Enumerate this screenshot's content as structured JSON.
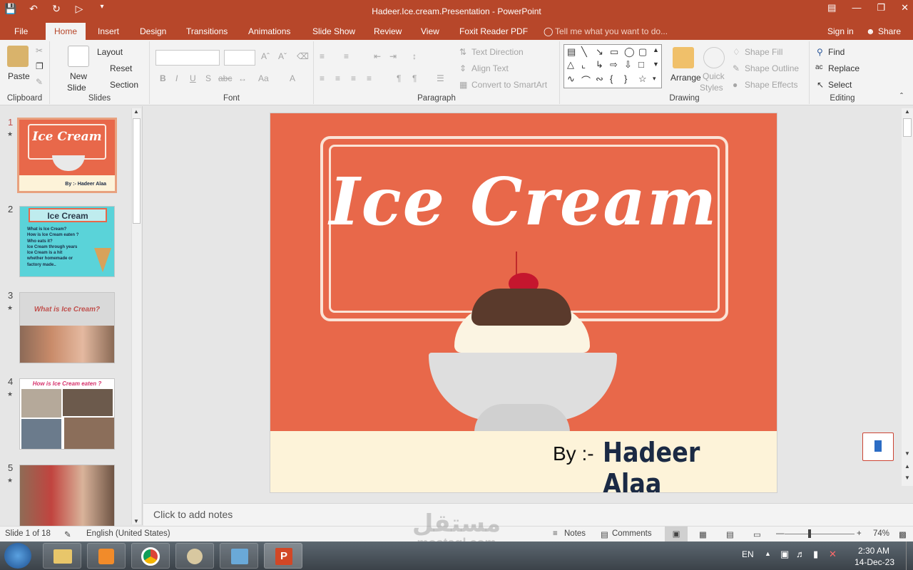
{
  "window": {
    "title": "Hadeer.Ice.cream.Presentation - PowerPoint"
  },
  "tabs": [
    "File",
    "Home",
    "Insert",
    "Design",
    "Transitions",
    "Animations",
    "Slide Show",
    "Review",
    "View",
    "Foxit Reader PDF"
  ],
  "tell_me": "Tell me what you want to do...",
  "sign_in": "Sign in",
  "share": "Share",
  "ribbon": {
    "clipboard": {
      "label": "Clipboard",
      "paste": "Paste"
    },
    "slides": {
      "label": "Slides",
      "new_slide": "New",
      "new_slide2": "Slide",
      "layout": "Layout",
      "reset": "Reset",
      "section": "Section"
    },
    "font": {
      "label": "Font"
    },
    "paragraph": {
      "label": "Paragraph",
      "text_direction": "Text Direction",
      "align_text": "Align Text",
      "convert_smartart": "Convert to SmartArt"
    },
    "drawing": {
      "label": "Drawing",
      "arrange": "Arrange",
      "quick": "Quick",
      "styles": "Styles",
      "shape_fill": "Shape Fill",
      "shape_outline": "Shape Outline",
      "shape_effects": "Shape Effects"
    },
    "editing": {
      "label": "Editing",
      "find": "Find",
      "replace": "Replace",
      "select": "Select"
    }
  },
  "thumbnails": [
    {
      "num": "1",
      "title": "Ice Cream",
      "sub": "By :- Hadeer Alaa"
    },
    {
      "num": "2",
      "title": "Ice Cream",
      "bullets": [
        "What is Ice Cream?",
        "How is Ice Cream eaten ?",
        "Who eats it?",
        "Ice Cream through years",
        "Ice Cream is a hit",
        "whether homemade or",
        "factory made.."
      ]
    },
    {
      "num": "3",
      "title": "What is Ice Cream?"
    },
    {
      "num": "4",
      "title": "How is Ice Cream eaten ?"
    },
    {
      "num": "5"
    }
  ],
  "slide": {
    "title": "Ice Cream",
    "by": "By :- ",
    "author": "Hadeer Alaa"
  },
  "notes_placeholder": "Click to add notes",
  "status": {
    "slide_of": "Slide 1 of 18",
    "language": "English (United States)",
    "notes": "Notes",
    "comments": "Comments",
    "zoom": "74%"
  },
  "taskbar": {
    "lang": "EN",
    "time": "2:30 AM",
    "date": "14-Dec-23"
  },
  "watermark": {
    "arabic": "مستقل",
    "latin": "mostaql.com"
  },
  "colors": {
    "accent": "#b7472a",
    "slide_bg": "#e8684a",
    "cream": "#fdf3d9",
    "author": "#1b2a44"
  }
}
